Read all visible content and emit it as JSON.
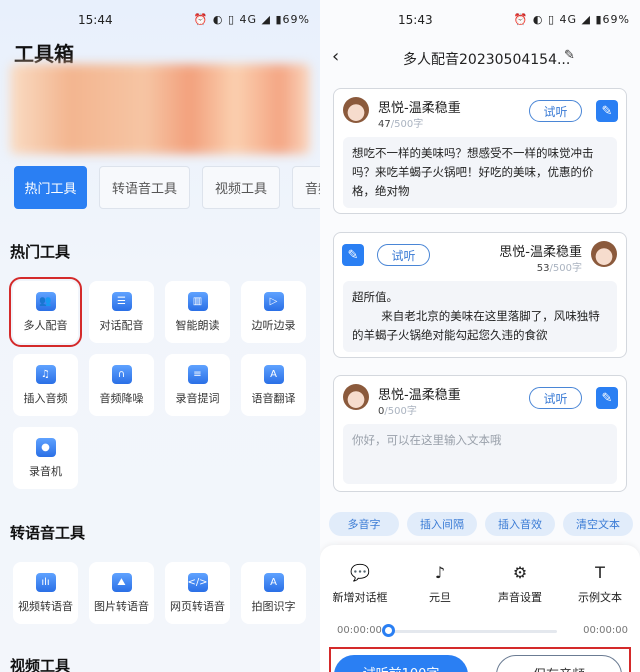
{
  "left": {
    "status": {
      "time": "15:44",
      "icons": "⏰ ◐ ▯ 4G ◢ ▮69%"
    },
    "title": "工具箱",
    "tabs": [
      "热门工具",
      "转语音工具",
      "视频工具",
      "音频"
    ],
    "sections": [
      {
        "title": "热门工具",
        "items": [
          {
            "label": "多人配音",
            "icon": "users-icon",
            "g": "👥"
          },
          {
            "label": "对话配音",
            "icon": "chat-icon",
            "g": "☰"
          },
          {
            "label": "智能朗读",
            "icon": "book-icon",
            "g": "▥"
          },
          {
            "label": "边听边录",
            "icon": "video-icon",
            "g": "▷"
          },
          {
            "label": "插入音频",
            "icon": "music-icon",
            "g": "♫"
          },
          {
            "label": "音频降噪",
            "icon": "headphones-icon",
            "g": "∩"
          },
          {
            "label": "录音提词",
            "icon": "prompter-icon",
            "g": "≡"
          },
          {
            "label": "语音翻译",
            "icon": "translate-icon",
            "g": "A"
          },
          {
            "label": "录音机",
            "icon": "radio-icon",
            "g": "●"
          }
        ]
      },
      {
        "title": "转语音工具",
        "items": [
          {
            "label": "视频转语音",
            "icon": "waveform-icon",
            "g": "ılı"
          },
          {
            "label": "图片转语音",
            "icon": "image-icon",
            "g": "⛰"
          },
          {
            "label": "网页转语音",
            "icon": "code-icon",
            "g": "</>"
          },
          {
            "label": "拍图识字",
            "icon": "scan-text-icon",
            "g": "A"
          }
        ]
      },
      {
        "title": "视频工具"
      }
    ]
  },
  "right": {
    "status": {
      "time": "15:43",
      "icons": "⏰ ◐ ▯ 4G ◢ ▮69%"
    },
    "title": "多人配音20230504154...",
    "cards": [
      {
        "name": "思悦-温柔稳重",
        "count": "47",
        "max": "/500字",
        "listen": "试听",
        "text": "想吃不一样的美味吗？想感受不一样的味觉冲击吗？来吃羊蝎子火锅吧！好吃的美味，优惠的价格，绝对物"
      },
      {
        "name": "思悦-温柔稳重",
        "count": "53",
        "max": "/500字",
        "listen": "试听",
        "text": "超所值。\n        来自老北京的美味在这里落脚了，风味独特的羊蝎子火锅绝对能勾起您久违的食欲"
      },
      {
        "name": "思悦-温柔稳重",
        "count": "0",
        "max": "/500字",
        "listen": "试听",
        "placeholder": "你好，可以在这里输入文本哦"
      }
    ],
    "chips": [
      "多音字",
      "插入间隔",
      "插入音效",
      "清空文本"
    ],
    "actions": [
      {
        "label": "新增对话框",
        "icon": "add-dialog-icon",
        "g": "💬"
      },
      {
        "label": "元旦",
        "icon": "music-note-icon",
        "g": "♪"
      },
      {
        "label": "声音设置",
        "icon": "gear-icon",
        "g": "⚙"
      },
      {
        "label": "示例文本",
        "icon": "text-icon",
        "g": "T"
      }
    ],
    "player": {
      "current": "00:00:00",
      "total": "00:00:00",
      "progress": 0
    },
    "buttons": {
      "primary": "试听前100字",
      "secondary": "保存音频"
    }
  },
  "colors": {
    "accent": "#2a7ff3",
    "highlight": "#d42a2a"
  }
}
